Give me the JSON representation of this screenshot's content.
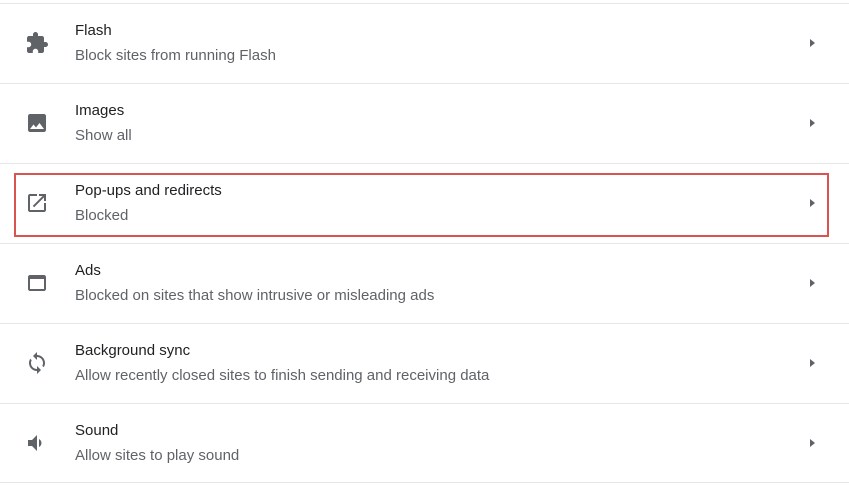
{
  "settings": {
    "items": [
      {
        "title": "Flash",
        "subtitle": "Block sites from running Flash",
        "icon": "puzzle-icon"
      },
      {
        "title": "Images",
        "subtitle": "Show all",
        "icon": "image-icon"
      },
      {
        "title": "Pop-ups and redirects",
        "subtitle": "Blocked",
        "icon": "open-in-new-icon"
      },
      {
        "title": "Ads",
        "subtitle": "Blocked on sites that show intrusive or misleading ads",
        "icon": "browser-window-icon"
      },
      {
        "title": "Background sync",
        "subtitle": "Allow recently closed sites to finish sending and receiving data",
        "icon": "sync-icon"
      },
      {
        "title": "Sound",
        "subtitle": "Allow sites to play sound",
        "icon": "volume-icon"
      }
    ]
  },
  "colors": {
    "icon": "#5f6368",
    "highlight_border": "#d9534f",
    "title": "#202124",
    "subtitle": "#5f6368"
  }
}
